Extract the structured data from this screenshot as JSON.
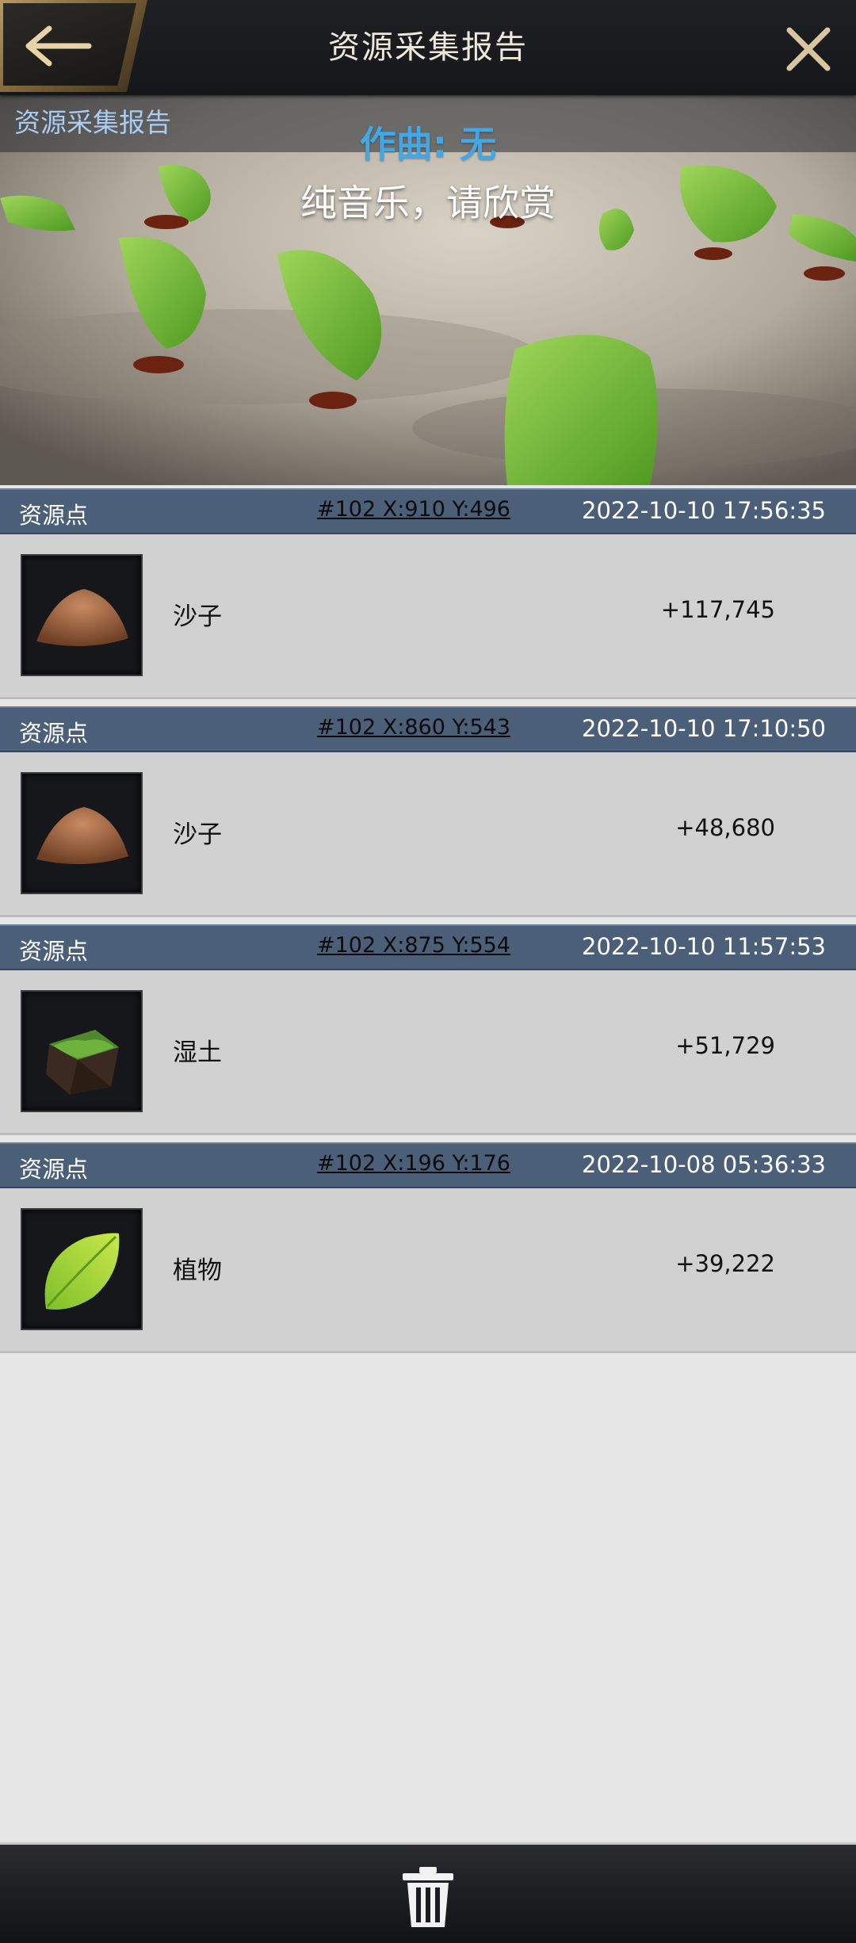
{
  "header": {
    "title": "资源采集报告",
    "back_icon": "arrow-left-icon",
    "close_icon": "close-icon"
  },
  "banner": {
    "label": "资源采集报告",
    "composer": "作曲: 无",
    "lyric": "纯音乐，请欣赏"
  },
  "records": [
    {
      "type": "资源点",
      "coord": "#102  X:910  Y:496",
      "time": "2022-10-10 17:56:35",
      "resource": "沙子",
      "amount": "+117,745",
      "icon": "sand-pile-icon"
    },
    {
      "type": "资源点",
      "coord": "#102  X:860  Y:543",
      "time": "2022-10-10 17:10:50",
      "resource": "沙子",
      "amount": "+48,680",
      "icon": "sand-pile-icon"
    },
    {
      "type": "资源点",
      "coord": "#102  X:875  Y:554",
      "time": "2022-10-10 11:57:53",
      "resource": "湿土",
      "amount": "+51,729",
      "icon": "wet-soil-icon"
    },
    {
      "type": "资源点",
      "coord": "#102  X:196  Y:176",
      "time": "2022-10-08 05:36:33",
      "resource": "植物",
      "amount": "+39,222",
      "icon": "leaf-icon"
    }
  ],
  "footer": {
    "delete_icon": "trash-icon"
  }
}
